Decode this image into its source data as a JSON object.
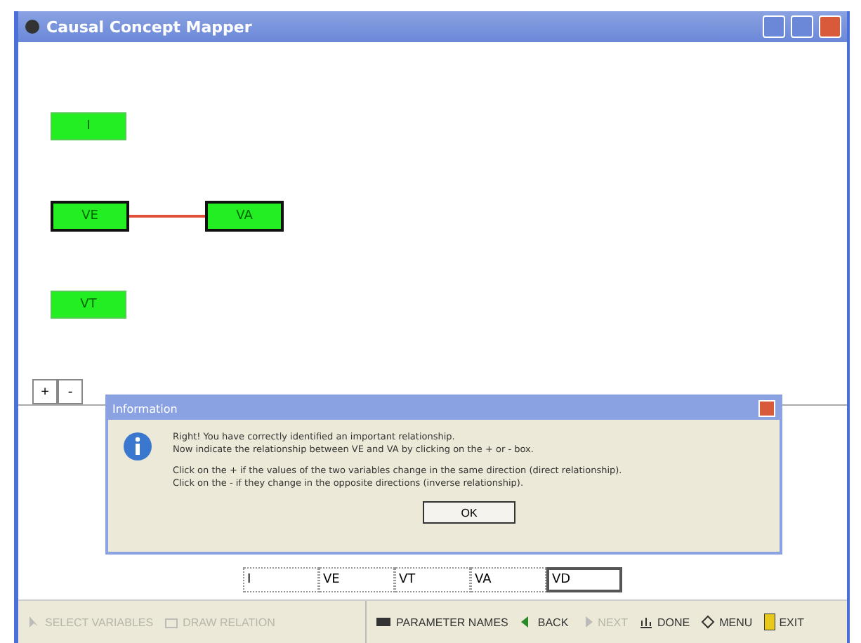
{
  "window": {
    "title": "Causal Concept Mapper"
  },
  "node_rows": [
    {
      "nodes": [
        {
          "label": "I",
          "bold_border": false
        }
      ]
    },
    {
      "linked": true,
      "nodes": [
        {
          "label": "VE",
          "bold_border": true
        },
        {
          "label": "VA",
          "bold_border": true
        }
      ]
    },
    {
      "nodes": [
        {
          "label": "VT",
          "bold_border": false
        }
      ]
    }
  ],
  "sign_buttons": [
    "+",
    "-"
  ],
  "dialog": {
    "title": "Information",
    "paragraphs": [
      "Right! You have correctly identified an important relationship.\nNow indicate the relationship between VE and VA by clicking on the + or - box.",
      "Click on the + if the values of the two variables change in the same direction (direct relationship).\nClick on the - if they change in the opposite directions (inverse relationship)."
    ],
    "button": "OK"
  },
  "variables": [
    {
      "label": "I",
      "selected": false
    },
    {
      "label": "VE",
      "selected": false
    },
    {
      "label": "VT",
      "selected": false
    },
    {
      "label": "VA",
      "selected": false
    },
    {
      "label": "VD",
      "selected": true
    }
  ],
  "toolbar_left": [
    {
      "label": "SELECT VARIABLES",
      "disabled": true
    },
    {
      "label": "DRAW RELATION",
      "disabled": true
    }
  ],
  "toolbar_right": [
    {
      "label": "PARAMETER NAMES",
      "disabled": false
    },
    {
      "label": "BACK",
      "disabled": false
    },
    {
      "label": "NEXT",
      "disabled": true
    },
    {
      "label": "DONE",
      "disabled": false
    },
    {
      "label": "MENU",
      "disabled": false
    },
    {
      "label": "EXIT",
      "disabled": false
    }
  ]
}
